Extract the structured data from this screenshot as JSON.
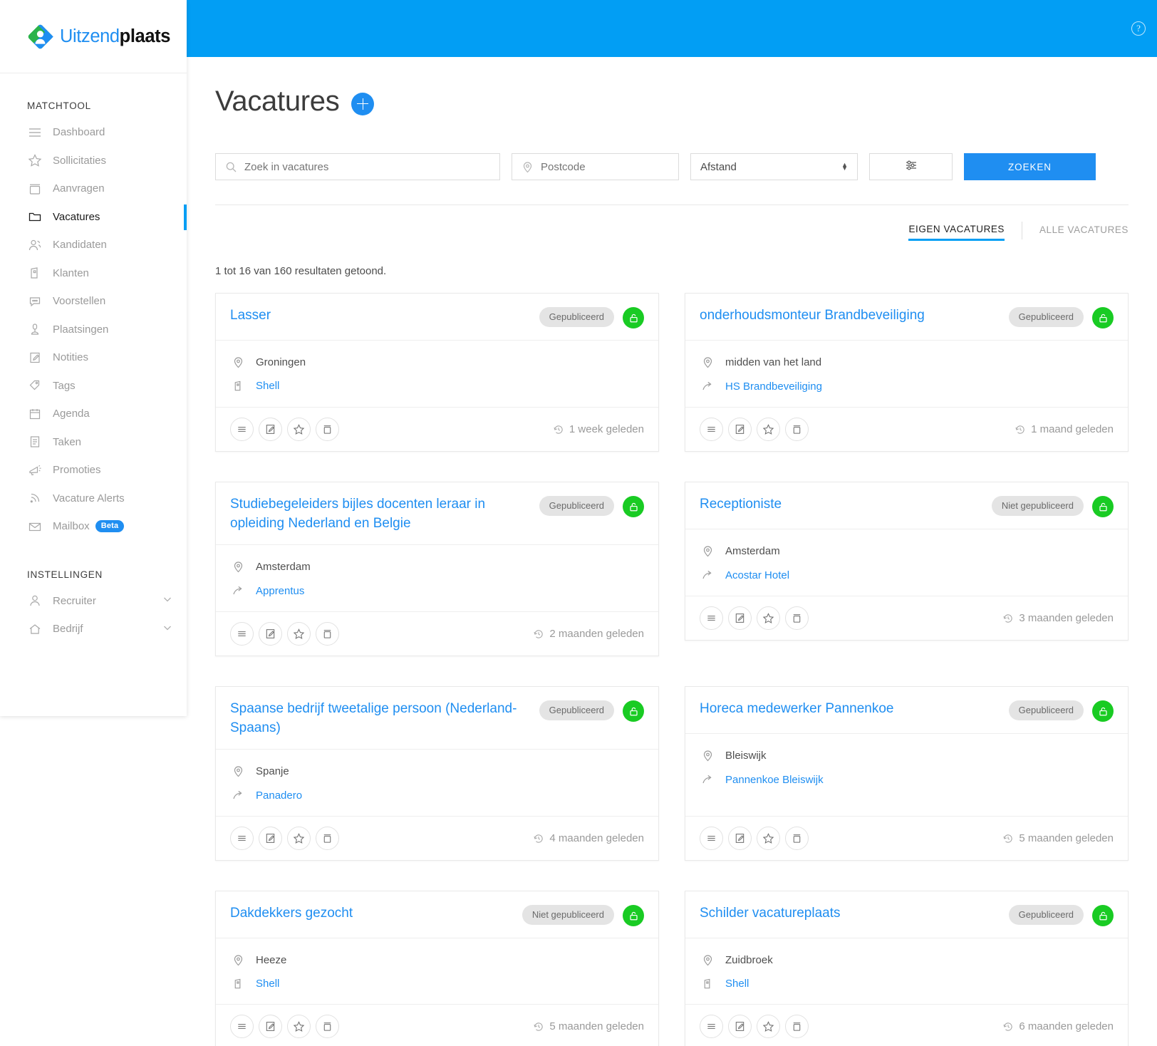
{
  "topbar": {
    "help_label": "?"
  },
  "brand": {
    "name_light": "Uitzend",
    "name_bold": "plaats"
  },
  "sidebar": {
    "section_matchtool": "MATCHTOOL",
    "section_instellingen": "INSTELLINGEN",
    "items": [
      {
        "label": "Dashboard",
        "icon": "dashboard-icon",
        "active": false
      },
      {
        "label": "Sollicitaties",
        "icon": "star-icon",
        "active": false
      },
      {
        "label": "Aanvragen",
        "icon": "briefcase-icon",
        "active": false
      },
      {
        "label": "Vacatures",
        "icon": "folder-icon",
        "active": true
      },
      {
        "label": "Kandidaten",
        "icon": "users-icon",
        "active": false
      },
      {
        "label": "Klanten",
        "icon": "building-icon",
        "active": false
      },
      {
        "label": "Voorstellen",
        "icon": "chat-icon",
        "active": false
      },
      {
        "label": "Plaatsingen",
        "icon": "placement-icon",
        "active": false
      },
      {
        "label": "Notities",
        "icon": "note-edit-icon",
        "active": false
      },
      {
        "label": "Tags",
        "icon": "tag-icon",
        "active": false
      },
      {
        "label": "Agenda",
        "icon": "calendar-icon",
        "active": false
      },
      {
        "label": "Taken",
        "icon": "tasks-icon",
        "active": false
      },
      {
        "label": "Promoties",
        "icon": "megaphone-icon",
        "active": false
      },
      {
        "label": "Vacature Alerts",
        "icon": "rss-icon",
        "active": false
      },
      {
        "label": "Mailbox",
        "icon": "mail-icon",
        "active": false,
        "badge": "Beta"
      }
    ],
    "settings_items": [
      {
        "label": "Recruiter",
        "icon": "person-icon"
      },
      {
        "label": "Bedrijf",
        "icon": "home-icon"
      }
    ]
  },
  "header": {
    "title": "Vacatures",
    "add_button_label": "+"
  },
  "search": {
    "query_placeholder": "Zoek in vacatures",
    "query_value": "",
    "postcode_placeholder": "Postcode",
    "postcode_value": "",
    "distance_value": "Afstand",
    "distance_options": [
      "Afstand"
    ],
    "filter_button_label": "",
    "submit_label": "ZOEKEN"
  },
  "tabs": [
    {
      "label": "EIGEN VACATURES",
      "active": true
    },
    {
      "label": "ALLE VACATURES",
      "active": false
    }
  ],
  "results": {
    "count_text": "1 tot 16 van 160 resultaten getoond."
  },
  "cards": [
    {
      "title": "Lasser",
      "status": "Gepubliceerd",
      "location": "Groningen",
      "company": "Shell",
      "company_icon": "building-icon",
      "time": "1 week geleden"
    },
    {
      "title": "onderhoudsmonteur Brandbeveiliging",
      "status": "Gepubliceerd",
      "location": "midden van het land",
      "company": "HS Brandbeveiliging",
      "company_icon": "share-arrow-icon",
      "time": "1 maand geleden"
    },
    {
      "title": "Studiebegeleiders bijles docenten leraar in opleiding Nederland en Belgie",
      "status": "Gepubliceerd",
      "location": "Amsterdam",
      "company": "Apprentus",
      "company_icon": "share-arrow-icon",
      "time": "2 maanden geleden"
    },
    {
      "title": "Receptioniste",
      "status": "Niet gepubliceerd",
      "location": "Amsterdam",
      "company": "Acostar Hotel",
      "company_icon": "share-arrow-icon",
      "time": "3 maanden geleden"
    },
    {
      "title": "Spaanse bedrijf tweetalige persoon (Nederland-Spaans)",
      "status": "Gepubliceerd",
      "location": "Spanje",
      "company": "Panadero",
      "company_icon": "share-arrow-icon",
      "time": "4 maanden geleden"
    },
    {
      "title": "Horeca medewerker Pannenkoe",
      "status": "Gepubliceerd",
      "location": "Bleiswijk",
      "company": "Pannenkoe Bleiswijk",
      "company_icon": "share-arrow-icon",
      "time": "5 maanden geleden"
    },
    {
      "title": "Dakdekkers gezocht",
      "status": "Niet gepubliceerd",
      "location": "Heeze",
      "company": "Shell",
      "company_icon": "building-icon",
      "time": "5 maanden geleden"
    },
    {
      "title": "Schilder vacatureplaats",
      "status": "Gepubliceerd",
      "location": "Zuidbroek",
      "company": "Shell",
      "company_icon": "building-icon",
      "time": "6 maanden geleden"
    }
  ],
  "card_actions": [
    {
      "name": "details-icon"
    },
    {
      "name": "edit-icon"
    },
    {
      "name": "favorite-star-icon"
    },
    {
      "name": "archive-icon"
    }
  ],
  "colors": {
    "brand_blue": "#029ef4",
    "link_blue": "#1f8ef1",
    "status_green": "#19cb23",
    "badge_gray": "#e4e4e4"
  }
}
